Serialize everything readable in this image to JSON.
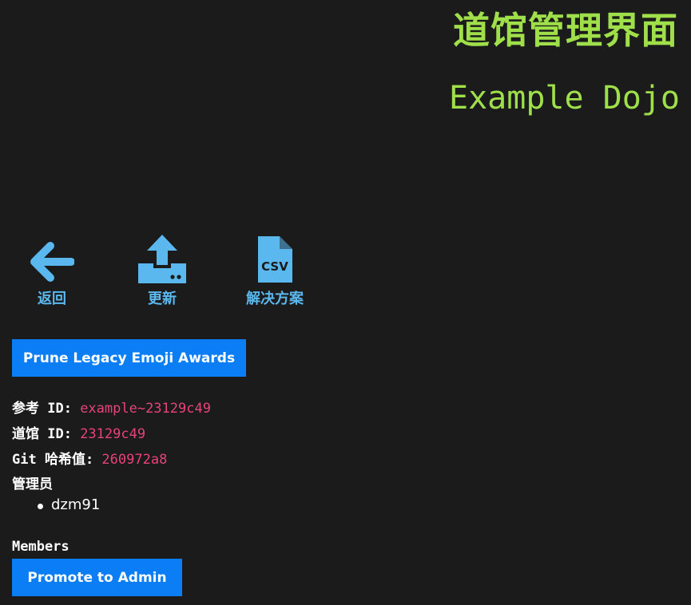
{
  "header": {
    "title": "道馆管理界面",
    "dojo_name": "Example Dojo"
  },
  "actions": [
    {
      "label": "返回",
      "icon": "arrow-left-icon"
    },
    {
      "label": "更新",
      "icon": "upload-icon"
    },
    {
      "label": "解决方案",
      "icon": "csv-file-icon"
    }
  ],
  "buttons": {
    "prune": "Prune Legacy Emoji Awards",
    "promote": "Promote to Admin"
  },
  "info": {
    "ref_label": "参考 ID: ",
    "ref_value": "example~23129c49",
    "dojo_label": "道馆 ID: ",
    "dojo_value": "23129c49",
    "git_label": "Git 哈希值: ",
    "git_value": "260972a8",
    "admins_heading": "管理员",
    "admins": [
      "dzm91"
    ],
    "members_heading": "Members"
  },
  "colors": {
    "background": "#1b1b1b",
    "title": "#9fe04a",
    "icon": "#5bb8ef",
    "button": "#0b7ef6",
    "code": "#e8427a"
  }
}
